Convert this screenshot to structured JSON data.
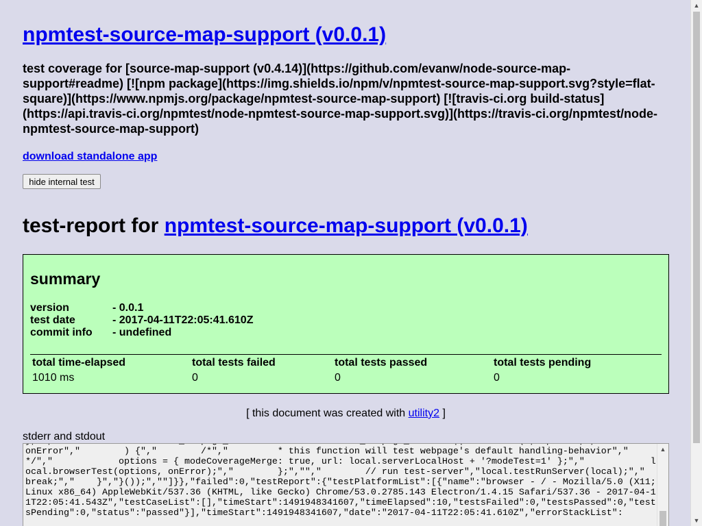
{
  "header": {
    "title": "npmtest-source-map-support (v0.0.1)",
    "description": "test coverage for [source-map-support (v0.4.14)](https://github.com/evanw/node-source-map-support#readme) [![npm package](https://img.shields.io/npm/v/npmtest-source-map-support.svg?style=flat-square)](https://www.npmjs.org/package/npmtest-source-map-support) [![travis-ci.org build-status](https://api.travis-ci.org/npmtest/node-npmtest-source-map-support.svg)](https://travis-ci.org/npmtest/node-npmtest-source-map-support)",
    "download_label": "download standalone app",
    "hide_button_label": "hide internal test"
  },
  "report": {
    "title_prefix": "test-report for ",
    "title_link": "npmtest-source-map-support (v0.0.1)"
  },
  "summary": {
    "heading": "summary",
    "version_label": "version",
    "version_value": "- 0.0.1",
    "test_date_label": "test date",
    "test_date_value": "- 2017-04-11T22:05:41.610Z",
    "commit_info_label": "commit info",
    "commit_info_value": "- undefined",
    "columns": [
      {
        "header": "total time-elapsed",
        "value": "1010 ms"
      },
      {
        "header": "total tests failed",
        "value": "0"
      },
      {
        "header": "total tests passed",
        "value": "0"
      },
      {
        "header": "total tests pending",
        "value": "0"
      }
    ]
  },
  "footer": {
    "created_prefix": "[ this document was created with ",
    "created_link": "utility2",
    "created_suffix": " ]",
    "stderr_label": "stderr and stdout"
  },
  "log": {
    "text": "}, \",\"        local.testCase_webpage_default = local.testCase_webpage_default || function (\",\"options,\",\"             onError\",\"        ) {\",\"        /*\",\"         * this function will test webpage's default handling-behavior\",\"         */\",\"            options = { modeCoverageMerge: true, url: local.serverLocalHost + '?modeTest=1' };\",\"            local.browserTest(options, onError);\",\"        };\",\"\",\"        // run test-server\",\"local.testRunServer(local);\",\"        break;\",\"    }\",\"}());\",\"\"]}},\"failed\":0,\"testReport\":{\"testPlatformList\":[{\"name\":\"browser - / - Mozilla/5.0 (X11; Linux x86_64) AppleWebKit/537.36 (KHTML, like Gecko) Chrome/53.0.2785.143 Electron/1.4.15 Safari/537.36 - 2017-04-11T22:05:41.543Z\",\"testCaseList\":[],\"timeStart\":1491948341607,\"timeElapsed\":10,\"testsFailed\":0,\"testsPassed\":0,\"testsPending\":0,\"status\":\"passed\"}],\"timeStart\":1491948341607,\"date\":\"2017-04-11T22:05:41.610Z\",\"errorStackList\":"
  },
  "icons": {
    "scroll_up": "▲",
    "scroll_down": "▼"
  }
}
